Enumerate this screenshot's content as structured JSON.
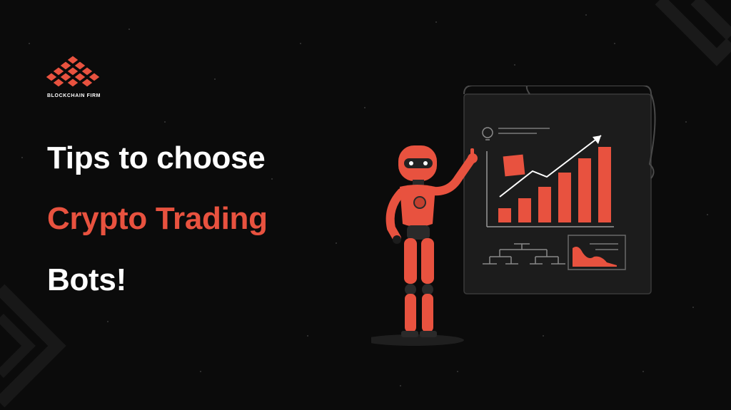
{
  "brand": {
    "name": "BLOCKCHAIN FIRM",
    "logo_icon": "stacked-cubes-logo-icon",
    "accent_color": "#e8523f"
  },
  "headline": {
    "line1": "Tips to choose",
    "line2": "Crypto Trading",
    "line3": "Bots!"
  },
  "illustration": {
    "subject": "robot-presenting-bar-chart-icon",
    "board_color": "#1c1c1c",
    "bar_color": "#e8523f"
  },
  "colors": {
    "background": "#0b0b0b",
    "text_primary": "#ffffff",
    "accent": "#e8523f"
  }
}
